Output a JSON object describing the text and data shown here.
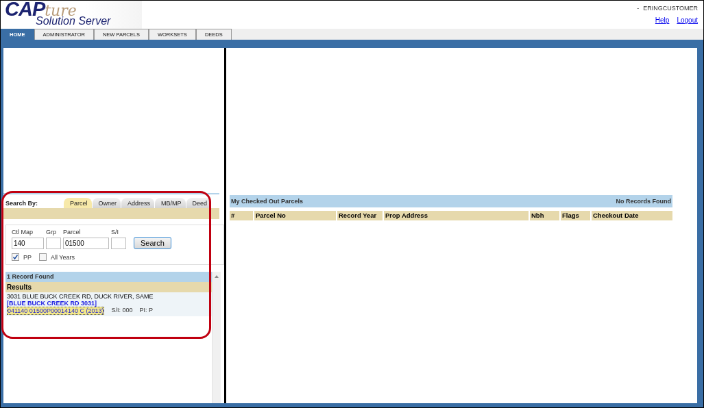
{
  "logo": {
    "main": "CAP",
    "script": "ture",
    "sub": "Solution Server"
  },
  "user": {
    "prefix": "-",
    "name": "ERINGCUSTOMER"
  },
  "header_links": [
    "Help",
    "Logout"
  ],
  "nav_tabs": [
    {
      "label": "HOME",
      "selected": true
    },
    {
      "label": "ADMINISTRATOR",
      "selected": false
    },
    {
      "label": "NEW PARCELS",
      "selected": false
    },
    {
      "label": "WORKSETS",
      "selected": false
    },
    {
      "label": "DEEDS",
      "selected": false
    }
  ],
  "search": {
    "label": "Search By:",
    "tabs": [
      {
        "label": "Parcel",
        "selected": true
      },
      {
        "label": "Owner",
        "selected": false
      },
      {
        "label": "Address",
        "selected": false
      },
      {
        "label": "MB/MP",
        "selected": false
      },
      {
        "label": "Deed",
        "selected": false
      }
    ],
    "fields": [
      {
        "label": "Ctl Map",
        "value": "140"
      },
      {
        "label": "Grp"
      },
      {
        "label": "Parcel",
        "value": "01500"
      },
      {
        "label": "S/I"
      }
    ],
    "button": "Search",
    "checks": [
      {
        "label": "PP",
        "checked": true
      },
      {
        "label": "All Years",
        "checked": false
      }
    ]
  },
  "results": {
    "count": "1 Record Found",
    "header": "Results",
    "items": [
      {
        "address": "3031 BLUE BUCK CREEK RD, DUCK RIVER, SAME",
        "link": "[BLUE BUCK CREEK RD 3031]",
        "parcel": "041140 01500P00014140 C (2013)",
        "si": "S/I: 000",
        "pi": "PI: P"
      }
    ]
  },
  "checked_out": {
    "title": "My Checked Out Parcels",
    "status": "No Records Found",
    "columns": [
      "#",
      "Parcel No",
      "Record Year",
      "Prop Address",
      "Nbh",
      "Flags",
      "Checkout Date"
    ]
  }
}
